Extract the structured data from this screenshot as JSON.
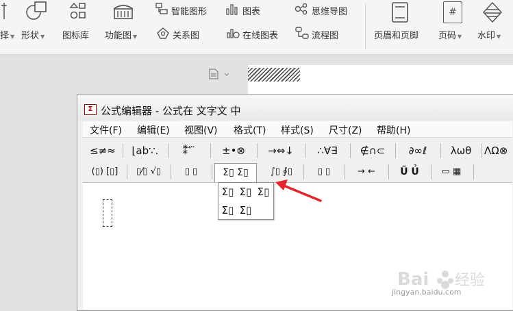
{
  "ribbon": {
    "partial_left_label": "择",
    "shape_label": "形状",
    "icon_lib_label": "图标库",
    "func_chart_label": "功能图",
    "smart_graphic_label": "智能图形",
    "chart_label": "图表",
    "mindmap_label": "思维导图",
    "relation_label": "关系图",
    "online_chart_label": "在线图表",
    "flowchart_label": "流程图",
    "header_footer_label": "页眉和页脚",
    "page_num_label": "页码",
    "watermark_label": "水印",
    "page_num_glyph": "#"
  },
  "equation_editor": {
    "title": "公式编辑器 - 公式在 文字文 中",
    "title_icon": "Σ",
    "menus": [
      "文件(F)",
      "编辑(E)",
      "视图(V)",
      "格式(T)",
      "样式(S)",
      "尺寸(Z)",
      "帮助(H)"
    ],
    "toolbar_row1": [
      "≤≠≈",
      "⌊ab∵.",
      "⁑ ⃗ ⃛",
      "±•⊗",
      "→⇔↓",
      "∴∀∃",
      "∉∩⊂",
      "∂∞ℓ",
      "λωθ",
      "ΛΩ⊗"
    ],
    "toolbar_row2": [
      "(▯) [▯]",
      "▯⁄▯ √▯",
      "▯ ▯",
      "Σ▯ Σ▯",
      "∫▯ ∮▯",
      "▯ ▯",
      "→ ←",
      "Ũ Ủ",
      "▭ ▦"
    ],
    "palette_row1": [
      "Σ▯",
      "Σ▯",
      "Σ▯"
    ],
    "palette_row2": [
      "Σ▯",
      "Σ▯"
    ]
  },
  "watermark": {
    "brand": "Bai经验",
    "url": "jingyan.baidu.com"
  },
  "colors": {
    "annotation_arrow": "#e0262b",
    "title_icon": "#b00000"
  }
}
